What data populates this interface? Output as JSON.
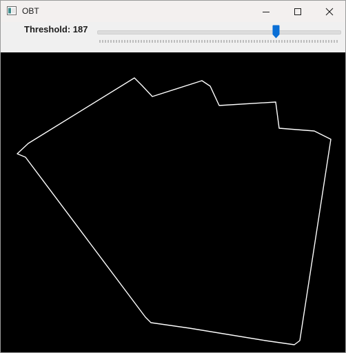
{
  "window": {
    "title": "OBT",
    "controls": {
      "minimize": "minimize-icon",
      "maximize": "maximize-icon",
      "close": "close-icon"
    }
  },
  "toolbar": {
    "slider_label": "Threshold: 187",
    "threshold": 187,
    "slider_range": [
      0,
      255
    ]
  },
  "canvas": {
    "background": "#000000",
    "edge_color": "#ffffff"
  },
  "colors": {
    "titlebar": "#f3f0ef",
    "toolbar": "#f0f0f0",
    "slider_thumb": "#0a6fd6"
  }
}
